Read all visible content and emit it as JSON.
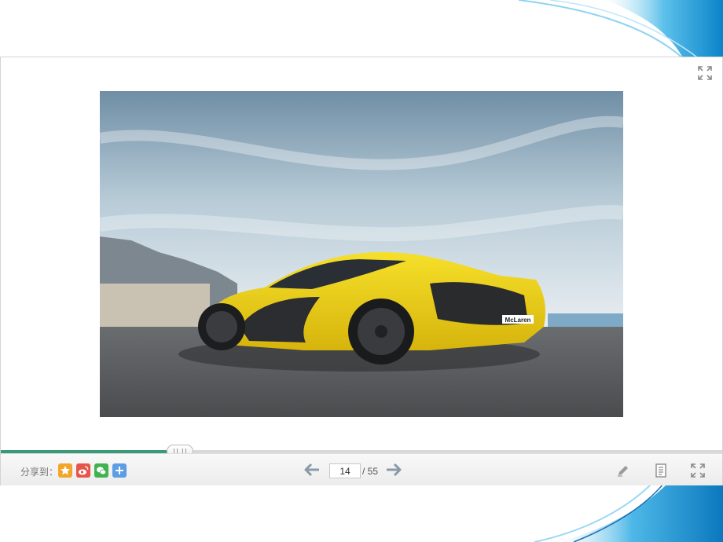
{
  "share": {
    "label": "分享到："
  },
  "share_buttons": [
    {
      "name": "qzone",
      "icon": "star-icon",
      "color": "#f2a52a"
    },
    {
      "name": "weibo",
      "icon": "weibo-icon",
      "color": "#e5554a"
    },
    {
      "name": "wechat",
      "icon": "wechat-icon",
      "color": "#3fb34f"
    },
    {
      "name": "more",
      "icon": "plus-icon",
      "color": "#5b9ee6"
    }
  ],
  "pagination": {
    "current": "14",
    "total_text": "/ 55"
  },
  "progress": {
    "fraction": 0.248
  },
  "slide": {
    "image": "yellow-sports-car-photo",
    "badge": "McLaren"
  },
  "colors": {
    "accent": "#3a9a78",
    "deco_blue": "#1f9bd7"
  }
}
